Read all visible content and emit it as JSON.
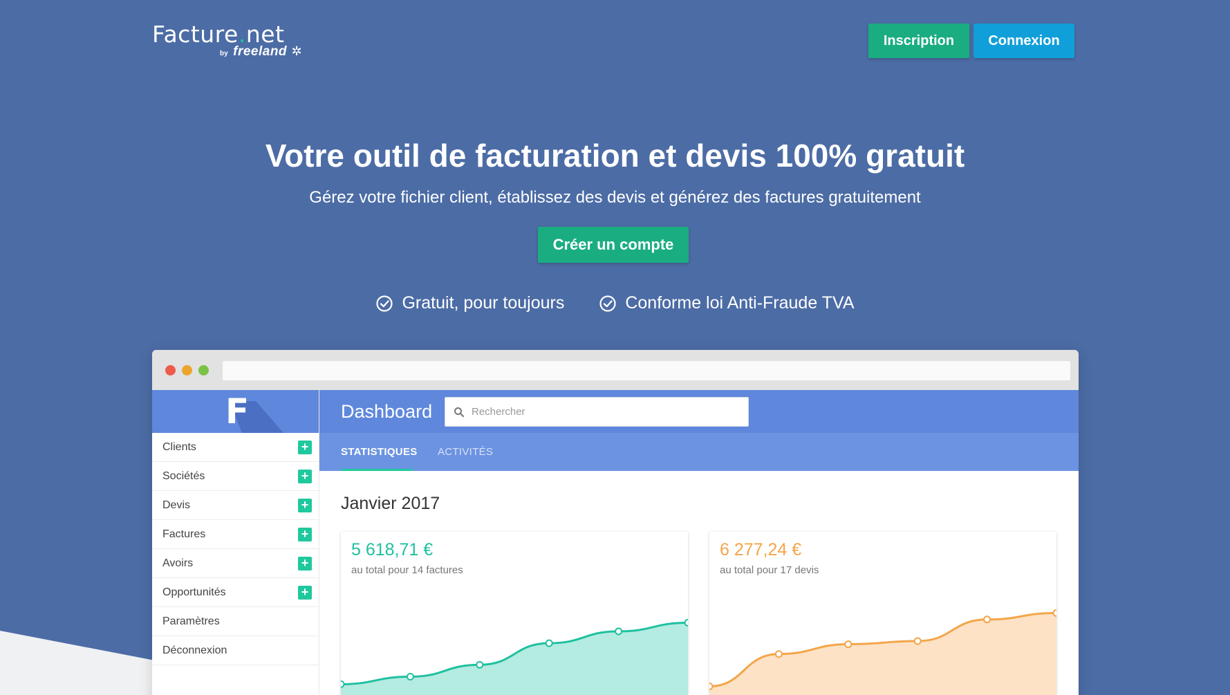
{
  "header": {
    "logo_main": "Facture",
    "logo_dot": ".",
    "logo_tld": "net",
    "logo_by": "by",
    "logo_brand": "freeland",
    "inscription_label": "Inscription",
    "connexion_label": "Connexion"
  },
  "hero": {
    "title": "Votre outil de facturation et devis 100% gratuit",
    "subtitle": "Gérez votre fichier client, établissez des devis et générez des factures gratuitement",
    "cta_label": "Créer un compte",
    "features": [
      "Gratuit, pour toujours",
      "Conforme loi Anti-Fraude TVA"
    ]
  },
  "app": {
    "logo_letter": "F",
    "title": "Dashboard",
    "search_placeholder": "Rechercher",
    "sidebar": [
      {
        "label": "Clients",
        "add": true
      },
      {
        "label": "Sociétés",
        "add": true
      },
      {
        "label": "Devis",
        "add": true
      },
      {
        "label": "Factures",
        "add": true
      },
      {
        "label": "Avoirs",
        "add": true
      },
      {
        "label": "Opportunités",
        "add": true
      },
      {
        "label": "Paramètres",
        "add": false
      },
      {
        "label": "Déconnexion",
        "add": false
      }
    ],
    "tabs": [
      "STATISTIQUES",
      "ACTIVITÉS"
    ],
    "month": "Janvier 2017",
    "cards": [
      {
        "value": "5 618,71 €",
        "subtitle": "au total pour 14 factures"
      },
      {
        "value": "6 277,24 €",
        "subtitle": "au total pour 17 devis"
      }
    ]
  },
  "colors": {
    "background": "#4c6ca5",
    "green": "#1aad82",
    "blue": "#119fd9",
    "chart_green": "#1fc0a0",
    "chart_orange": "#f3a64a"
  },
  "chart_data": [
    {
      "type": "area",
      "series": [
        {
          "values": [
            10,
            17,
            28,
            48,
            59,
            67
          ]
        }
      ],
      "ylim": [
        0,
        100
      ]
    },
    {
      "type": "area",
      "series": [
        {
          "values": [
            8,
            38,
            47,
            50,
            70,
            76
          ]
        }
      ],
      "ylim": [
        0,
        100
      ]
    }
  ]
}
